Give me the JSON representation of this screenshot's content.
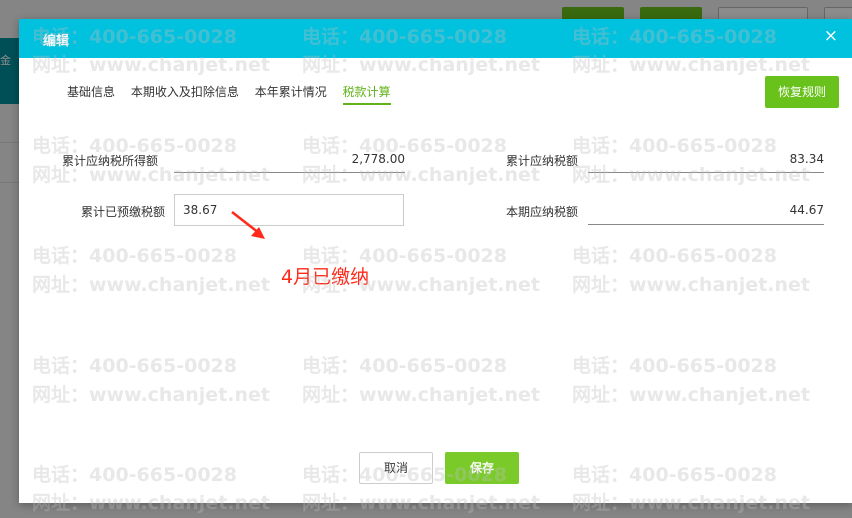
{
  "background": {
    "side_label": "金"
  },
  "dialog": {
    "title": "编辑",
    "close_symbol": "×",
    "tabs": [
      {
        "label": "基础信息",
        "active": false
      },
      {
        "label": "本期收入及扣除信息",
        "active": false
      },
      {
        "label": "本年累计情况",
        "active": false
      },
      {
        "label": "税款计算",
        "active": true
      }
    ],
    "restore_button": "恢复规则",
    "fields": {
      "cumulative_taxable_income_label": "累计应纳税所得额",
      "cumulative_taxable_income_value": "2,778.00",
      "cumulative_tax_payable_label": "累计应纳税额",
      "cumulative_tax_payable_value": "83.34",
      "cumulative_prepaid_tax_label": "累计已预缴税额",
      "cumulative_prepaid_tax_value": "38.67",
      "current_tax_payable_label": "本期应纳税额",
      "current_tax_payable_value": "44.67"
    },
    "annotation": "4月已缴纳",
    "cancel_button": "取消",
    "save_button": "保存"
  },
  "watermark": {
    "phone": "电话：400-665-0028",
    "site": "网址：www.chanjet.net"
  },
  "colors": {
    "header": "#00c1de",
    "accent_green": "#69c21c",
    "annotation_red": "#ff2a1a"
  }
}
